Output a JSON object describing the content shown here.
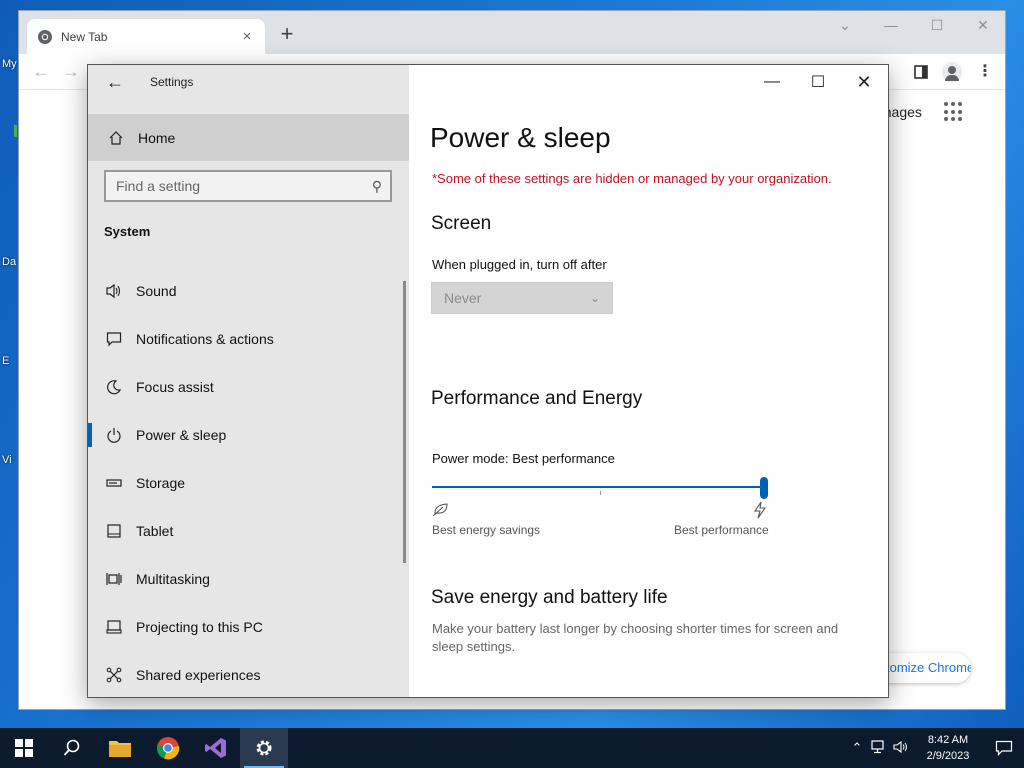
{
  "desktop": {
    "labels": [
      "My",
      "Da",
      "E",
      "Vi"
    ]
  },
  "chrome": {
    "tab_title": "New Tab",
    "tab_close": "×",
    "new_tab": "+",
    "images_link": "Images",
    "customize_label": "tomize Chrome"
  },
  "settings": {
    "app_title": "Settings",
    "sidebar": {
      "home_label": "Home",
      "search_placeholder": "Find a setting",
      "section_heading": "System",
      "items": [
        {
          "label": "Sound",
          "icon": "speaker-icon"
        },
        {
          "label": "Notifications & actions",
          "icon": "notification-icon"
        },
        {
          "label": "Focus assist",
          "icon": "moon-icon"
        },
        {
          "label": "Power & sleep",
          "icon": "power-icon",
          "active": true
        },
        {
          "label": "Storage",
          "icon": "storage-icon"
        },
        {
          "label": "Tablet",
          "icon": "tablet-icon"
        },
        {
          "label": "Multitasking",
          "icon": "multitasking-icon"
        },
        {
          "label": "Projecting to this PC",
          "icon": "projecting-icon"
        },
        {
          "label": "Shared experiences",
          "icon": "shared-icon"
        }
      ]
    },
    "content": {
      "page_title": "Power & sleep",
      "managed_warning": "*Some of these settings are hidden or managed by your organization.",
      "screen_heading": "Screen",
      "plugged_label": "When plugged in, turn off after",
      "plugged_value": "Never",
      "performance_heading": "Performance and Energy",
      "power_mode_label": "Power mode: Best performance",
      "power_mode_level": 1.0,
      "slider_min_label": "Best energy savings",
      "slider_max_label": "Best performance",
      "save_heading": "Save energy and battery life",
      "save_desc": "Make your battery last longer by choosing shorter times for screen and sleep settings."
    }
  },
  "taskbar": {
    "time": "8:42 AM",
    "date": "2/9/2023"
  },
  "colors": {
    "accent": "#0063b1",
    "warning": "#c50f1f"
  }
}
